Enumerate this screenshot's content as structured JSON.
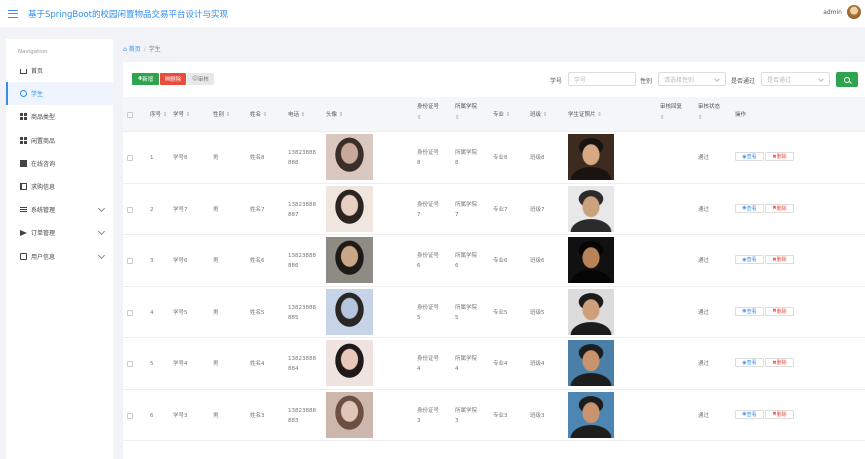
{
  "header": {
    "title": "基于SpringBoot的校园闲置物品交易平台设计与实现",
    "user": "admin"
  },
  "sidebar": {
    "title": "Navigation",
    "items": [
      {
        "label": "首页",
        "icon": "home-icon"
      },
      {
        "label": "学生",
        "icon": "person-icon"
      },
      {
        "label": "商品类型",
        "icon": "grid-icon"
      },
      {
        "label": "闲置商品",
        "icon": "grid-icon"
      },
      {
        "label": "在线咨询",
        "icon": "edit-icon"
      },
      {
        "label": "求购信息",
        "icon": "book-icon"
      },
      {
        "label": "系统管理",
        "icon": "sliders-icon"
      },
      {
        "label": "订单管理",
        "icon": "send-icon"
      },
      {
        "label": "用户信息",
        "icon": "card-icon"
      }
    ]
  },
  "breadcrumb": {
    "home": "首页",
    "sep": "/",
    "current": "学生"
  },
  "toolbar": {
    "add": "新增",
    "delete": "删除",
    "audit": "审核"
  },
  "filters": {
    "student_id_label": "学号",
    "student_id_placeholder": "学号",
    "gender_label": "性别",
    "gender_placeholder": "请选择性别",
    "approved_label": "是否通过",
    "approved_placeholder": "是否通过"
  },
  "columns": {
    "index": "序号",
    "student_id": "学号",
    "gender": "性别",
    "name": "姓名",
    "phone": "电话",
    "avatar": "头像",
    "id_card": "身份证号",
    "college": "所属学院",
    "major": "专业",
    "class": "班级",
    "photo": "学生证照片",
    "audit_reply": "审核回复",
    "audit_status": "审核状态",
    "actions": "操作",
    "sort": "⇕"
  },
  "rows": [
    {
      "index": "1",
      "student_id": "学号8",
      "gender": "男",
      "name": "姓名8",
      "phone1": "13823888",
      "phone2": "888",
      "id1": "身份证号",
      "id2": "8",
      "col1": "所属学院",
      "col2": "8",
      "major": "专业8",
      "class": "班级8",
      "status": "通过",
      "view": "查看",
      "del": "删除"
    },
    {
      "index": "2",
      "student_id": "学号7",
      "gender": "男",
      "name": "姓名7",
      "phone1": "13823888",
      "phone2": "887",
      "id1": "身份证号",
      "id2": "7",
      "col1": "所属学院",
      "col2": "7",
      "major": "专业7",
      "class": "班级7",
      "status": "通过",
      "view": "查看",
      "del": "删除"
    },
    {
      "index": "3",
      "student_id": "学号6",
      "gender": "男",
      "name": "姓名6",
      "phone1": "13823888",
      "phone2": "886",
      "id1": "身份证号",
      "id2": "6",
      "col1": "所属学院",
      "col2": "6",
      "major": "专业6",
      "class": "班级6",
      "status": "通过",
      "view": "查看",
      "del": "删除"
    },
    {
      "index": "4",
      "student_id": "学号5",
      "gender": "男",
      "name": "姓名5",
      "phone1": "13823888",
      "phone2": "885",
      "id1": "身份证号",
      "id2": "5",
      "col1": "所属学院",
      "col2": "5",
      "major": "专业5",
      "class": "班级5",
      "status": "通过",
      "view": "查看",
      "del": "删除"
    },
    {
      "index": "5",
      "student_id": "学号4",
      "gender": "男",
      "name": "姓名4",
      "phone1": "13823888",
      "phone2": "884",
      "id1": "身份证号",
      "id2": "4",
      "col1": "所属学院",
      "col2": "4",
      "major": "专业4",
      "class": "班级4",
      "status": "通过",
      "view": "查看",
      "del": "删除"
    },
    {
      "index": "6",
      "student_id": "学号3",
      "gender": "男",
      "name": "姓名3",
      "phone1": "13823888",
      "phone2": "883",
      "id1": "身份证号",
      "id2": "3",
      "col1": "所属学院",
      "col2": "3",
      "major": "专业3",
      "class": "班级3",
      "status": "通过",
      "view": "查看",
      "del": "删除"
    }
  ],
  "colors": {
    "accent": "#3a8ee6",
    "success": "#2ea44f",
    "danger": "#e74c3c"
  }
}
